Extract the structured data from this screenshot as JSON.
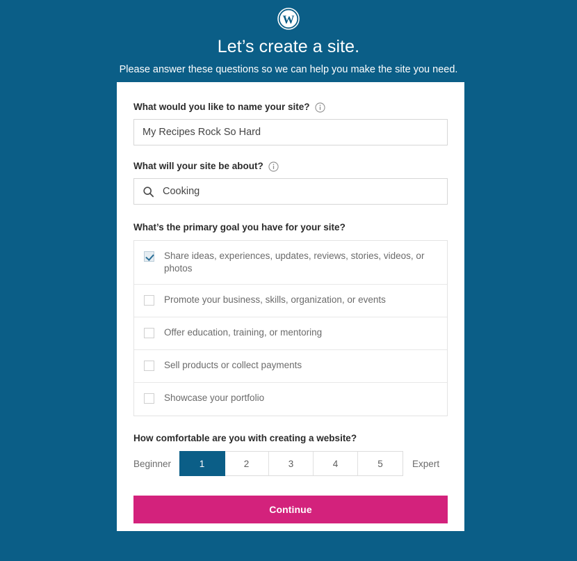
{
  "header": {
    "logo_icon": "wordpress-logo",
    "headline": "Let’s create a site.",
    "subhead": "Please answer these questions so we can help you make the site you need."
  },
  "form": {
    "site_name": {
      "label": "What would you like to name your site?",
      "info_icon": "info-circle-icon",
      "value": "My Recipes Rock So Hard"
    },
    "site_topic": {
      "label": "What will your site be about?",
      "info_icon": "info-circle-icon",
      "search_icon": "search-icon",
      "value": "Cooking"
    },
    "primary_goal": {
      "label": "What’s the primary goal you have for your site?",
      "options": [
        {
          "text": "Share ideas, experiences, updates, reviews, stories, videos, or photos",
          "checked": true
        },
        {
          "text": "Promote your business, skills, organization, or events",
          "checked": false
        },
        {
          "text": "Offer education, training, or mentoring",
          "checked": false
        },
        {
          "text": "Sell products or collect payments",
          "checked": false
        },
        {
          "text": "Showcase your portfolio",
          "checked": false
        }
      ]
    },
    "comfort": {
      "label": "How comfortable are you with creating a website?",
      "left_label": "Beginner",
      "right_label": "Expert",
      "scale": [
        "1",
        "2",
        "3",
        "4",
        "5"
      ],
      "selected": "1"
    },
    "submit_label": "Continue"
  },
  "colors": {
    "background": "#0b5e87",
    "accent": "#0b5e87",
    "cta": "#d3227c",
    "card": "#ffffff"
  }
}
